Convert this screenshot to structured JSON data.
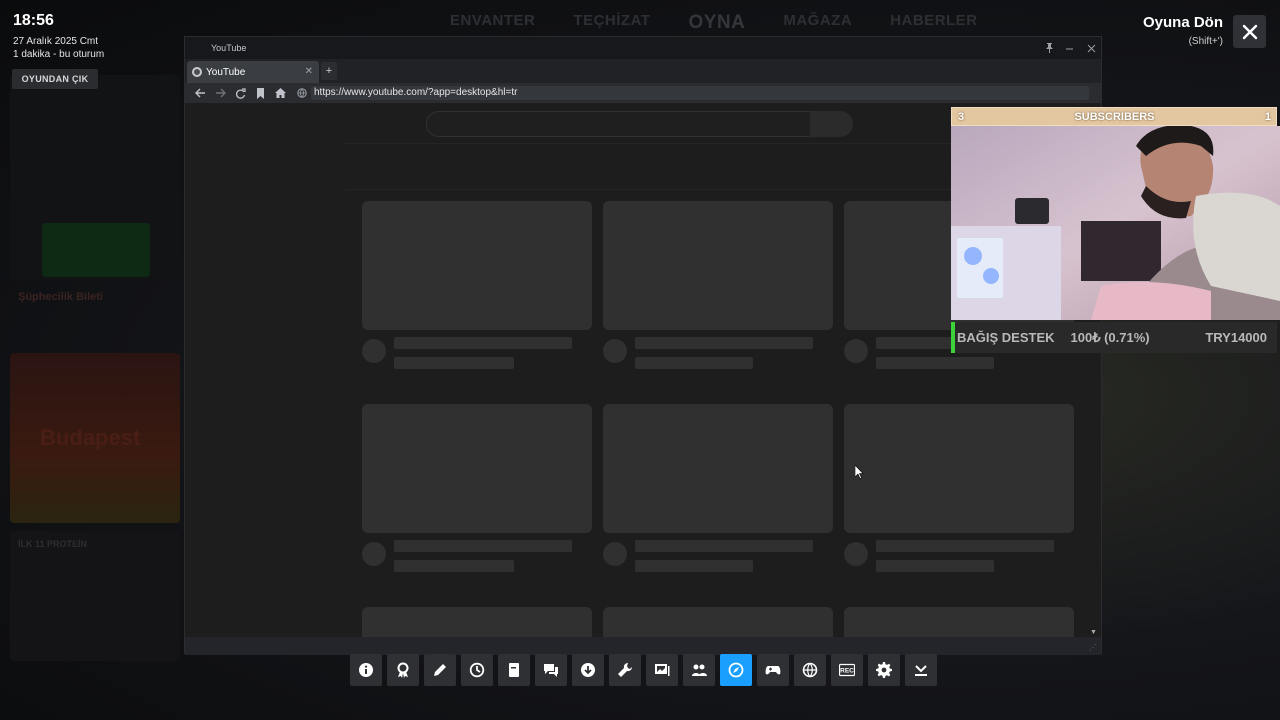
{
  "hud": {
    "time": "18:56",
    "date": "27 Aralık 2025 Cmt",
    "session": "1 dakika - bu oturum",
    "exit_game_label": "OYUNDAN ÇIK",
    "resume_label": "Oyuna Dön",
    "resume_shortcut": "(Shift+')"
  },
  "game_background": {
    "nav": [
      "ENVANTER",
      "TEÇHİZAT",
      "OYNA",
      "MAĞAZA",
      "HABERLER"
    ],
    "left_panel_texts": [
      "Şüphecilik Bileti",
      "İLK 11 PROTEİN",
      "Budapest"
    ]
  },
  "browser": {
    "window_title": "YouTube",
    "tab_label": "YouTube",
    "new_tab_label": "+",
    "url": "https://www.youtube.com/?app=desktop&hl=tr"
  },
  "overlay": {
    "subs_left": "3",
    "subs_title": "SUBSCRIBERS",
    "subs_right": "1",
    "donate_title": "BAĞIŞ DESTEK",
    "donate_amount": "100₺ (0.71%)",
    "donate_goal": "TRY14000"
  },
  "toolbar": {
    "buttons": [
      {
        "icon": "info-icon"
      },
      {
        "icon": "achievements-icon"
      },
      {
        "icon": "pencil-icon"
      },
      {
        "icon": "clock-icon"
      },
      {
        "icon": "guides-icon"
      },
      {
        "icon": "chat-icon"
      },
      {
        "icon": "download-icon"
      },
      {
        "icon": "wrench-icon"
      },
      {
        "icon": "screenshots-icon"
      },
      {
        "icon": "friends-icon"
      },
      {
        "icon": "browser-icon",
        "active": true
      },
      {
        "icon": "controller-icon"
      },
      {
        "icon": "globe-icon"
      },
      {
        "icon": "rec-icon",
        "label": "REC"
      },
      {
        "icon": "settings-icon"
      },
      {
        "icon": "collapse-icon"
      }
    ]
  },
  "colors": {
    "accent": "#1a9fff",
    "donate_accent": "#3bd23b",
    "subs_bar": "#e2c7a0"
  }
}
